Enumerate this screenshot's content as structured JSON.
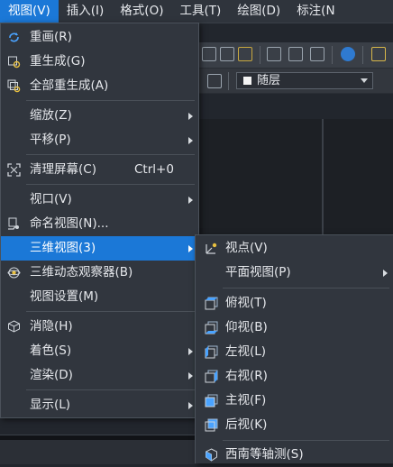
{
  "menubar": {
    "items": [
      {
        "label": "视图(V)"
      },
      {
        "label": "插入(I)"
      },
      {
        "label": "格式(O)"
      },
      {
        "label": "工具(T)"
      },
      {
        "label": "绘图(D)"
      },
      {
        "label": "标注(N"
      }
    ]
  },
  "layer": {
    "value": "随层"
  },
  "main_menu": {
    "items": [
      {
        "label": "重画(R)",
        "icon": "redraw-icon"
      },
      {
        "label": "重生成(G)",
        "icon": "regen-icon"
      },
      {
        "label": "全部重生成(A)",
        "icon": "regen-all-icon"
      },
      {
        "label": "缩放(Z)",
        "submenu": true
      },
      {
        "label": "平移(P)",
        "submenu": true
      },
      {
        "label": "清理屏幕(C)",
        "shortcut": "Ctrl+0",
        "icon": "clean-screen-icon"
      },
      {
        "label": "视口(V)",
        "submenu": true
      },
      {
        "label": "命名视图(N)...",
        "icon": "named-view-icon"
      },
      {
        "label": "三维视图(3)",
        "submenu": true,
        "highlighted": true
      },
      {
        "label": "三维动态观察器(B)",
        "icon": "orbit-icon"
      },
      {
        "label": "视图设置(M)"
      },
      {
        "label": "消隐(H)",
        "icon": "hide-icon"
      },
      {
        "label": "着色(S)",
        "submenu": true
      },
      {
        "label": "渲染(D)",
        "submenu": true
      },
      {
        "label": "显示(L)",
        "submenu": true
      }
    ]
  },
  "sub_menu": {
    "items": [
      {
        "label": "视点(V)",
        "icon": "viewpoint-icon"
      },
      {
        "label": "平面视图(P)",
        "submenu": true
      },
      {
        "label": "俯视(T)",
        "icon": "top-view-icon"
      },
      {
        "label": "仰视(B)",
        "icon": "bottom-view-icon"
      },
      {
        "label": "左视(L)",
        "icon": "left-view-icon"
      },
      {
        "label": "右视(R)",
        "icon": "right-view-icon"
      },
      {
        "label": "主视(F)",
        "icon": "front-view-icon"
      },
      {
        "label": "后视(K)",
        "icon": "back-view-icon"
      },
      {
        "label": "西南等轴测(S)",
        "icon": "sw-iso-icon"
      }
    ]
  },
  "colors": {
    "accent": "#1b78d7",
    "menu_bg": "#31363e",
    "menubar_bg": "#2f343c"
  }
}
